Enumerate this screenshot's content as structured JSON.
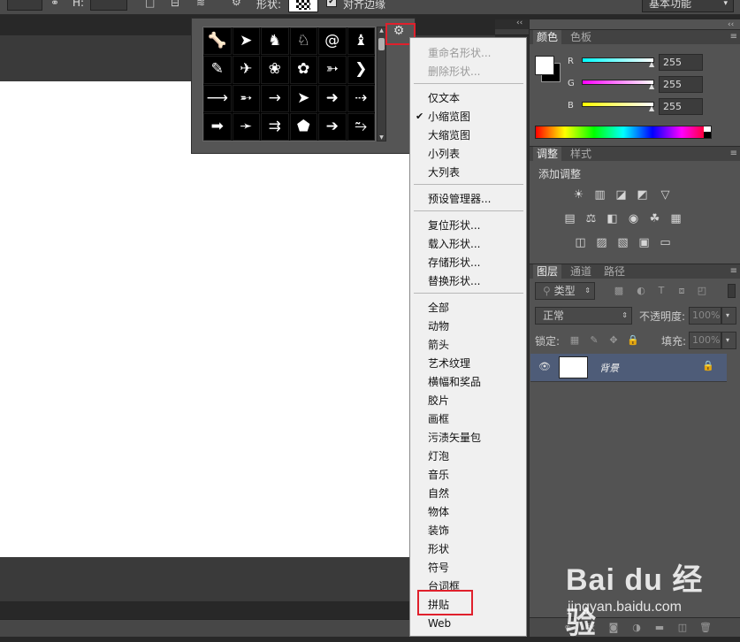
{
  "optionsbar": {
    "h_label": "H:",
    "shape_label": "形状:",
    "align_edges_label": "对齐边缘",
    "workspace": "基本功能"
  },
  "menu": {
    "items_top": [
      {
        "label": "重命名形状...",
        "disabled": true
      },
      {
        "label": "删除形状...",
        "disabled": true
      }
    ],
    "view_modes": [
      {
        "label": "仅文本"
      },
      {
        "label": "小缩览图",
        "checked": true
      },
      {
        "label": "大缩览图"
      },
      {
        "label": "小列表"
      },
      {
        "label": "大列表"
      }
    ],
    "preset_manager": "预设管理器...",
    "shape_ops": [
      "复位形状...",
      "载入形状...",
      "存储形状...",
      "替换形状..."
    ],
    "categories": [
      "全部",
      "动物",
      "箭头",
      "艺术纹理",
      "横幅和奖品",
      "胶片",
      "画框",
      "污渍矢量包",
      "灯泡",
      "音乐",
      "自然",
      "物体",
      "装饰",
      "形状",
      "符号",
      "台词框",
      "拼贴",
      "Web"
    ]
  },
  "color_panel": {
    "tabs": [
      "颜色",
      "色板"
    ],
    "r_label": "R",
    "g_label": "G",
    "b_label": "B",
    "r_value": "255",
    "g_value": "255",
    "b_value": "255"
  },
  "adjust_panel": {
    "tabs": [
      "调整",
      "样式"
    ],
    "heading": "添加调整"
  },
  "layers_panel": {
    "tabs": [
      "图层",
      "通道",
      "路径"
    ],
    "filter_label": "类型",
    "blend_mode": "正常",
    "opacity_label": "不透明度:",
    "opacity_value": "100%",
    "lock_label": "锁定:",
    "fill_label": "填充:",
    "fill_value": "100%",
    "layer_name": "背景"
  },
  "watermark": {
    "brand": "Bai du 经验",
    "url": "jingyan.baidu.com"
  },
  "colors": {
    "highlight_red": "#e0202c",
    "menu_bg": "#f0f0f0",
    "panel_bg": "#535353",
    "layer_selected": "#4e5c78"
  },
  "shape_icons": [
    "bone",
    "fish",
    "cat",
    "dog",
    "snail",
    "rabbit",
    "bird",
    "dove",
    "paw",
    "paw-2",
    "arrow-feather",
    "chevron",
    "arrow-thin",
    "arrow-feather-2",
    "arrow-long",
    "arrow-triangle",
    "arrow-bold",
    "arrow-dotted",
    "arrow-block",
    "arrow-pointer",
    "arrow-double",
    "arrow-pentagon",
    "arrow-bold-2",
    "arrow-wave"
  ]
}
